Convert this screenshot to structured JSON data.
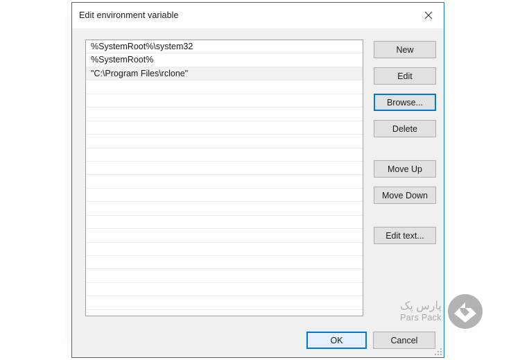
{
  "dialog": {
    "title": "Edit environment variable",
    "close_icon": "close-icon"
  },
  "list": {
    "entries": [
      "%SystemRoot%\\system32",
      "%SystemRoot%",
      "\"C:\\Program Files\\rclone\""
    ],
    "hovered_index": 2,
    "empty_row_count": 17
  },
  "side_buttons": [
    {
      "id": "new",
      "label": "New",
      "focused": false
    },
    {
      "id": "edit",
      "label": "Edit",
      "focused": false
    },
    {
      "id": "browse",
      "label": "Browse...",
      "focused": true
    },
    {
      "id": "delete",
      "label": "Delete",
      "focused": false
    },
    {
      "id": "move_up",
      "label": "Move Up",
      "focused": false
    },
    {
      "id": "move_down",
      "label": "Move Down",
      "focused": false
    },
    {
      "id": "edit_text",
      "label": "Edit text...",
      "focused": false
    }
  ],
  "footer": {
    "ok_label": "OK",
    "cancel_label": "Cancel"
  },
  "watermark": {
    "text_fa": "پارس پک",
    "text_en": "Pars Pack",
    "logo_icon": "parspack-diamond-logo"
  },
  "colors": {
    "accent": "#0078d7",
    "dialog_body": "#f0f0f0",
    "button_face": "#e1e1e1",
    "button_border": "#adadad",
    "listbox_border": "#a0a0a0",
    "row_hover": "#f2f2f2",
    "default_button_fill": "#e3f0fb",
    "watermark_gray": "#b0b0b0"
  }
}
